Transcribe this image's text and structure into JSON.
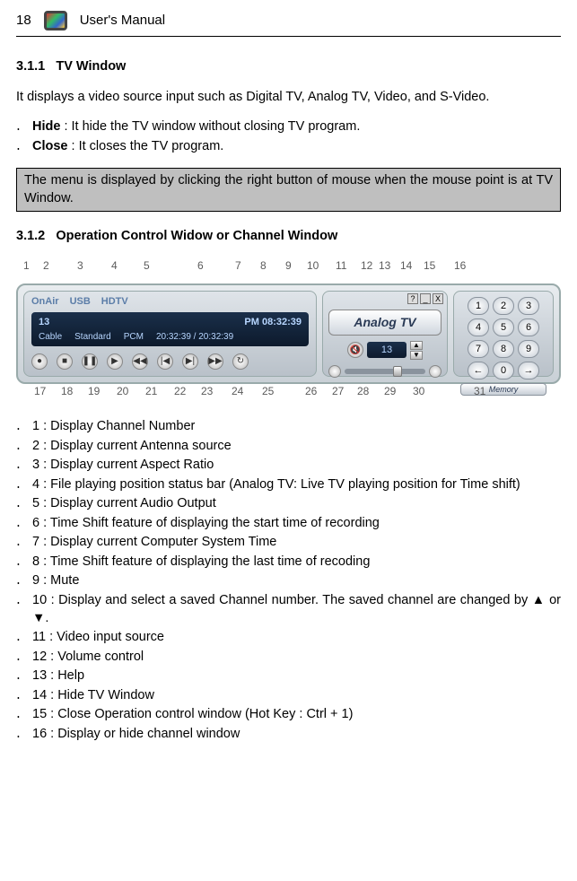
{
  "header": {
    "page": "18",
    "manual": "User's Manual"
  },
  "s311": {
    "num": "3.1.1",
    "title": "TV Window",
    "intro": "It displays a video source input such as Digital TV, Analog TV, Video, and S-Video.",
    "hide_label": "Hide",
    "hide_desc": " : It hide the TV window without closing TV program.",
    "close_label": "Close",
    "close_desc": " : It closes the TV program.",
    "note": "The menu is displayed by clicking the right button of mouse when the mouse point is at TV Window."
  },
  "s312": {
    "num": "3.1.2",
    "title": "Operation Control Widow or Channel Window"
  },
  "panel": {
    "onair": "OnAir",
    "usb": "USB",
    "hdtv": "HDTV",
    "ch": "13",
    "time": "PM 08:32:39",
    "cable": "Cable",
    "standard": "Standard",
    "pcm": "PCM",
    "pos": "20:32:39 / 20:32:39",
    "analog": "Analog TV",
    "spin": "13",
    "memory": "Memory",
    "keys": [
      "1",
      "2",
      "3",
      "4",
      "5",
      "6",
      "7",
      "8",
      "9",
      "←",
      "0",
      "→"
    ]
  },
  "topcalls": [
    "1",
    "2",
    "3",
    "4",
    "5",
    "6",
    "7",
    "8",
    "9",
    "10",
    "11",
    "12",
    "13",
    "14",
    "15",
    "16"
  ],
  "botcalls": [
    "17",
    "18",
    "19",
    "20",
    "21",
    "22",
    "23",
    "24",
    "25",
    "26",
    "27",
    "28",
    "29",
    "30",
    "31"
  ],
  "legend": [
    "1 : Display Channel Number",
    "2 : Display current Antenna source",
    "3 : Display current Aspect Ratio",
    "4 : File playing position status bar (Analog TV: Live TV playing position for Time shift)",
    "5 : Display current Audio Output",
    "6 : Time Shift feature of displaying the start time of recording",
    "7 : Display current Computer System Time",
    "8 : Time Shift feature of displaying the last time of recoding",
    "9 : Mute",
    "10 : Display and select a saved Channel number.   The saved channel are changed by ▲ or ▼.",
    "11 : Video input source",
    "12 : Volume control",
    "13 : Help",
    "14 : Hide TV Window",
    "15 : Close Operation control window (Hot Key : Ctrl + 1)",
    "16 : Display or hide channel window"
  ]
}
